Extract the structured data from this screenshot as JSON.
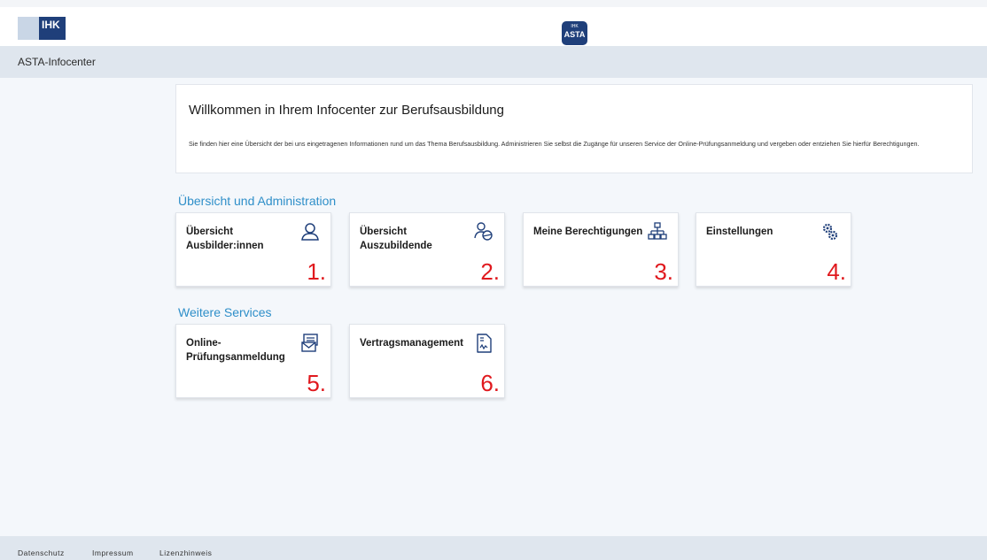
{
  "header": {
    "ihk_logo_text": "IHK",
    "asta_logo_small": "IHK",
    "asta_logo_big": "ASTA"
  },
  "subheader": {
    "title": "ASTA-Infocenter"
  },
  "welcome": {
    "title": "Willkommen in Ihrem Infocenter zur Berufsausbildung",
    "text": "Sie finden hier eine Übersicht der bei uns eingetragenen Informationen rund um das Thema Berufsausbildung. Administrieren Sie selbst die Zugänge für unseren Service der Online-Prüfungsanmeldung und vergeben oder entziehen Sie hierfür Berechtigungen."
  },
  "sections": {
    "admin_title": "Übersicht und Administration",
    "services_title": "Weitere Services"
  },
  "tiles": [
    {
      "label": "Übersicht Ausbilder:innen",
      "number": "1.",
      "icon": "person-icon"
    },
    {
      "label": "Übersicht Auszubildende",
      "number": "2.",
      "icon": "trainee-icon"
    },
    {
      "label": "Meine Berechtigungen",
      "number": "3.",
      "icon": "hierarchy-icon"
    },
    {
      "label": "Einstellungen",
      "number": "4.",
      "icon": "gears-icon"
    },
    {
      "label": "Online-Prüfungsanmeldung",
      "number": "5.",
      "icon": "mail-form-icon"
    },
    {
      "label": "Vertragsmanagement",
      "number": "6.",
      "icon": "contract-icon"
    }
  ],
  "footer": {
    "links": [
      "Datenschutz",
      "Impressum",
      "Lizenzhinweis"
    ]
  },
  "colors": {
    "brand_blue": "#1f3f7a",
    "section_title": "#2f8fc9",
    "annotation_red": "#e0191e"
  }
}
